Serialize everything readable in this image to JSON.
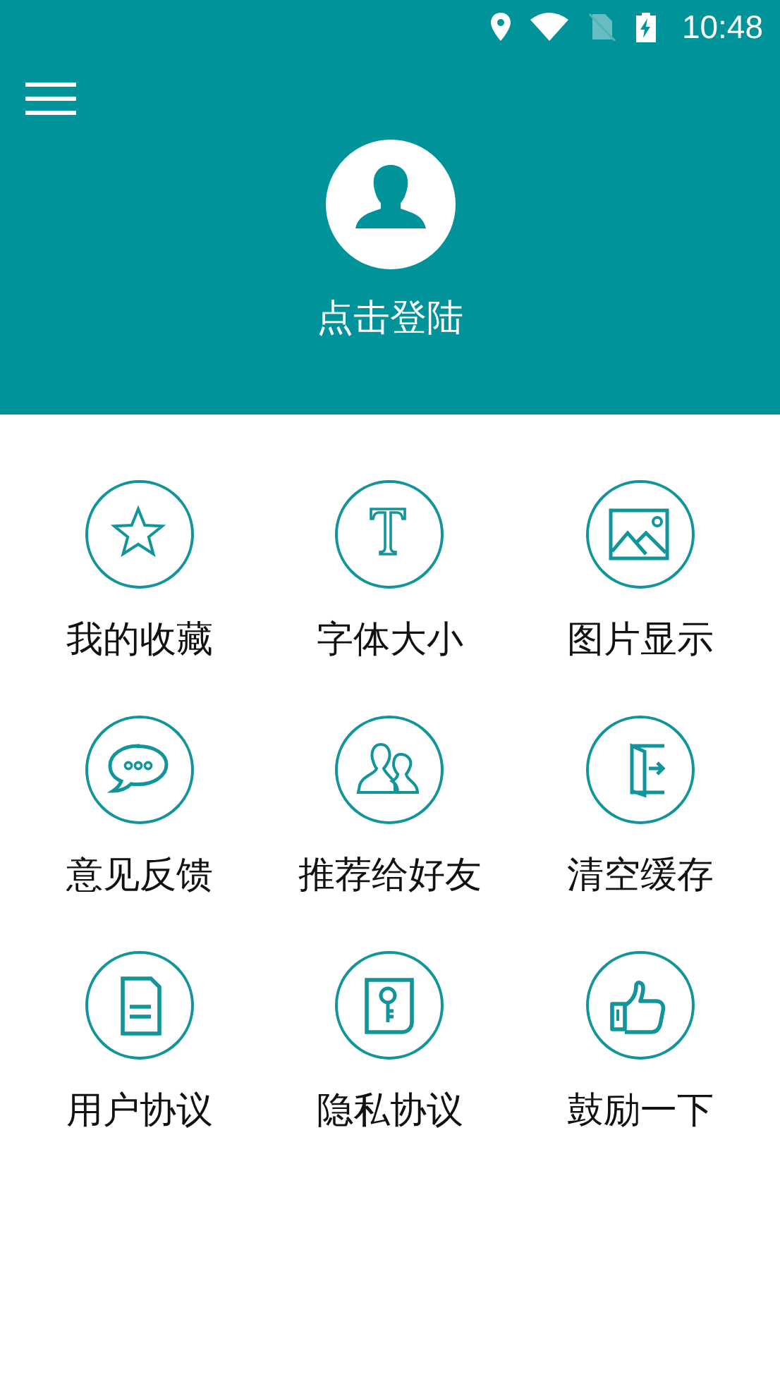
{
  "status_bar": {
    "time": "10:48"
  },
  "profile": {
    "login_label": "点击登陆"
  },
  "menu_grid": [
    {
      "label": "我的收藏"
    },
    {
      "label": "字体大小"
    },
    {
      "label": "图片显示"
    },
    {
      "label": "意见反馈"
    },
    {
      "label": "推荐给好友"
    },
    {
      "label": "清空缓存"
    },
    {
      "label": "用户协议"
    },
    {
      "label": "隐私协议"
    },
    {
      "label": "鼓励一下"
    }
  ]
}
